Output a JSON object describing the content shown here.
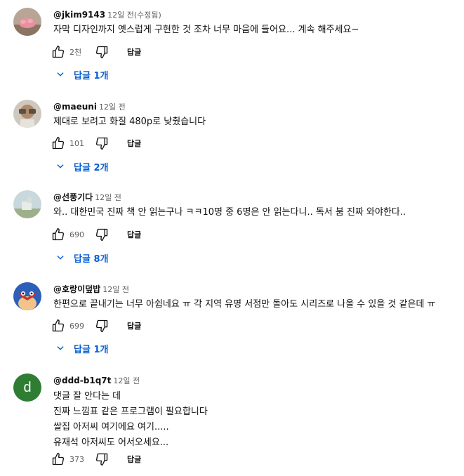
{
  "colors": {
    "link": "#065fd4",
    "secondary_text": "#606060",
    "primary_text": "#0f0f0f"
  },
  "reply_label": "답글",
  "comments": [
    {
      "author": "@jkim9143",
      "time": "12일 전(수정됨)",
      "lines": [
        "자막 디자인까지 옛스럽게 구현한 것 조차 너무 마음에 들어요... 계속 해주세요~"
      ],
      "likes": "2천",
      "replies_label": "답글 1개",
      "avatar_icon": "pink-flower-avatar"
    },
    {
      "author": "@maeuni",
      "time": "12일 전",
      "lines": [
        "제대로 보려고 화질 480p로 낮췄습니다"
      ],
      "likes": "101",
      "replies_label": "답글 2개",
      "avatar_icon": "photo-avatar"
    },
    {
      "author": "@선풍기다",
      "time": "12일 전",
      "lines": [
        "와.. 대한민국 진짜 책 안 읽는구나 ㅋㅋ10명 중 6명은 안 읽는다니.. 독서 붐 진짜 와야한다.."
      ],
      "likes": "690",
      "replies_label": "답글 8개",
      "avatar_icon": "landscape-avatar"
    },
    {
      "author": "@호랑이덮밥",
      "time": "12일 전",
      "lines": [
        "한편으로 끝내기는 너무 아쉽네요 ㅠ 각 지역 유명 서점만 돌아도 시리즈로 나올 수 있을 것 같은데 ㅠ"
      ],
      "likes": "699",
      "replies_label": "답글 1개",
      "avatar_icon": "cartoon-face-avatar"
    },
    {
      "author": "@ddd-b1q7t",
      "time": "12일 전",
      "lines": [
        "댓글 잘 안다는 데",
        "진짜 느낌표 같은 프로그램이 필요합니다",
        "쌀집 아저씨 여기에요 여기.....",
        "유재석 아저씨도 어서오세요..."
      ],
      "likes": "373",
      "replies_label": "",
      "avatar_letter": "d",
      "avatar_icon": "letter-avatar"
    }
  ]
}
